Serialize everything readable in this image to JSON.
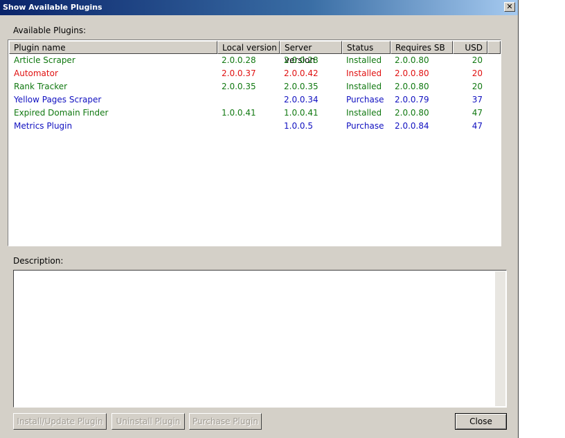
{
  "window": {
    "title": "Show Available Plugins",
    "close_glyph": "✕"
  },
  "labels": {
    "available_plugins": "Available Plugins:",
    "description": "Description:"
  },
  "table": {
    "columns": [
      "Plugin name",
      "Local version",
      "Server version",
      "Status",
      "Requires SB",
      "USD"
    ],
    "rows": [
      {
        "name": "Article Scraper",
        "local": "2.0.0.28",
        "server": "2.0.0.28",
        "status": "Installed",
        "requires": "2.0.0.80",
        "usd": "20",
        "color": "#107810"
      },
      {
        "name": "Automator",
        "local": "2.0.0.37",
        "server": "2.0.0.42",
        "status": "Installed",
        "requires": "2.0.0.80",
        "usd": "20",
        "color": "#e01010"
      },
      {
        "name": "Rank Tracker",
        "local": "2.0.0.35",
        "server": "2.0.0.35",
        "status": "Installed",
        "requires": "2.0.0.80",
        "usd": "20",
        "color": "#107810"
      },
      {
        "name": "Yellow Pages Scraper",
        "local": "",
        "server": "2.0.0.34",
        "status": "Purchase",
        "requires": "2.0.0.79",
        "usd": "37",
        "color": "#1010c0"
      },
      {
        "name": "Expired Domain Finder",
        "local": "1.0.0.41",
        "server": "1.0.0.41",
        "status": "Installed",
        "requires": "2.0.0.80",
        "usd": "47",
        "color": "#107810"
      },
      {
        "name": "Metrics Plugin",
        "local": "",
        "server": "1.0.0.5",
        "status": "Purchase",
        "requires": "2.0.0.84",
        "usd": "47",
        "color": "#1010c0"
      }
    ]
  },
  "buttons": {
    "install": "Install/Update Plugin",
    "uninstall": "Uninstall Plugin",
    "purchase": "Purchase Plugin",
    "close": "Close"
  }
}
